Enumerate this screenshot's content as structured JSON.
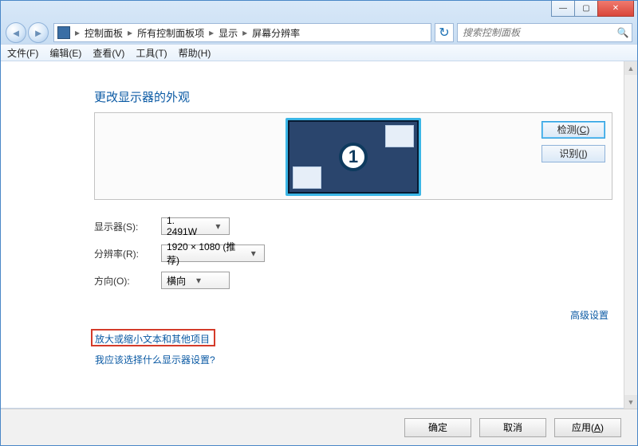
{
  "caption": {
    "min": "—",
    "max": "▢",
    "close": "✕"
  },
  "breadcrumb": {
    "p1": "控制面板",
    "p2": "所有控制面板项",
    "p3": "显示",
    "p4": "屏幕分辨率",
    "sep": "▸"
  },
  "search": {
    "placeholder": "搜索控制面板"
  },
  "menu": {
    "file": "文件(F)",
    "edit": "编辑(E)",
    "view": "查看(V)",
    "tools": "工具(T)",
    "help": "帮助(H)"
  },
  "page": {
    "title": "更改显示器的外观"
  },
  "preview": {
    "detect": "检测(",
    "detect_u": "C",
    "detect_end": ")",
    "identify": "识别(",
    "identify_u": "I",
    "identify_end": ")",
    "monitor_num": "1"
  },
  "form": {
    "monitor_label": "显示器(S):",
    "monitor_value": "1. 2491W",
    "resolution_label": "分辨率(R):",
    "resolution_value": "1920 × 1080 (推荐)",
    "orientation_label": "方向(O):",
    "orientation_value": "横向"
  },
  "links": {
    "advanced": "高级设置",
    "scale": "放大或缩小文本和其他项目",
    "which": "我应该选择什么显示器设置?"
  },
  "buttons": {
    "ok": "确定",
    "cancel": "取消",
    "apply_pre": "应用(",
    "apply_u": "A",
    "apply_end": ")"
  }
}
